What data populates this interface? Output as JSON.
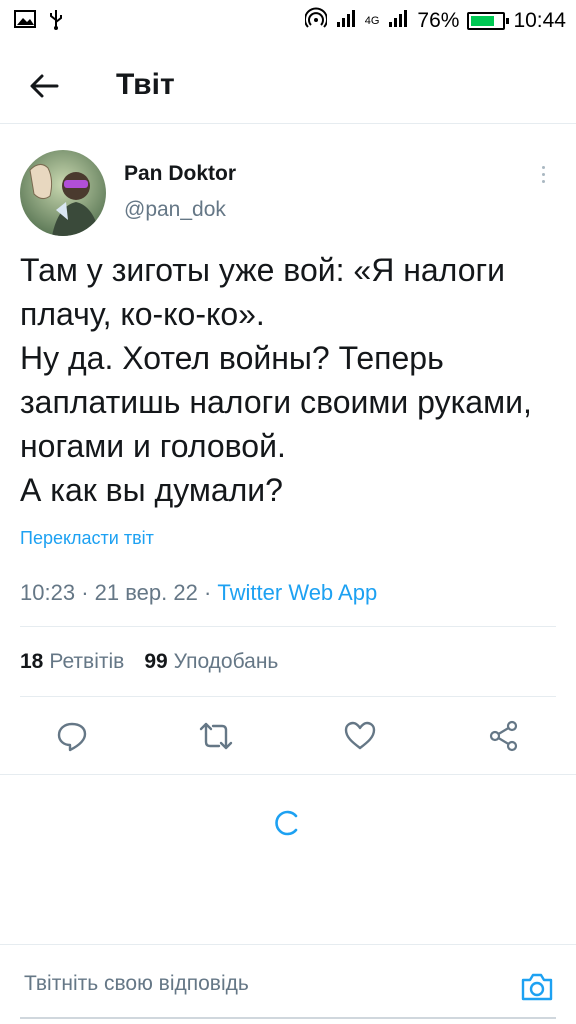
{
  "status_bar": {
    "battery_percent": "76%",
    "battery_level": 0.76,
    "time": "10:44",
    "network": "4G",
    "icons": [
      "image-icon",
      "usb-icon",
      "hotspot-icon",
      "signal-icon",
      "battery-icon"
    ]
  },
  "header": {
    "title": "Твіт",
    "back_icon": "arrow-left-icon"
  },
  "tweet": {
    "author_name": "Pan Doktor",
    "author_handle": "@pan_dok",
    "text": "Там у зиготы уже вой: «Я налоги плачу, ко-ко-ко».\nНу да. Хотел войны? Теперь заплатишь налоги своими руками, ногами и головой.\nА как вы думали?",
    "translate_link": "Перекласти твіт",
    "time": "10:23",
    "date": "21 вер. 22",
    "source": "Twitter Web App",
    "separator": "·"
  },
  "stats": {
    "retweets_count": "18",
    "retweets_label": "Ретвітів",
    "likes_count": "99",
    "likes_label": "Уподобань"
  },
  "actions": [
    "reply-icon",
    "retweet-icon",
    "like-icon",
    "share-icon"
  ],
  "reply_bar": {
    "placeholder": "Твітніть свою відповідь",
    "camera_icon": "camera-icon"
  },
  "colors": {
    "accent": "#1da1f2",
    "secondary_text": "#657786",
    "primary_text": "#14171a",
    "divider": "#e6ecf0"
  }
}
